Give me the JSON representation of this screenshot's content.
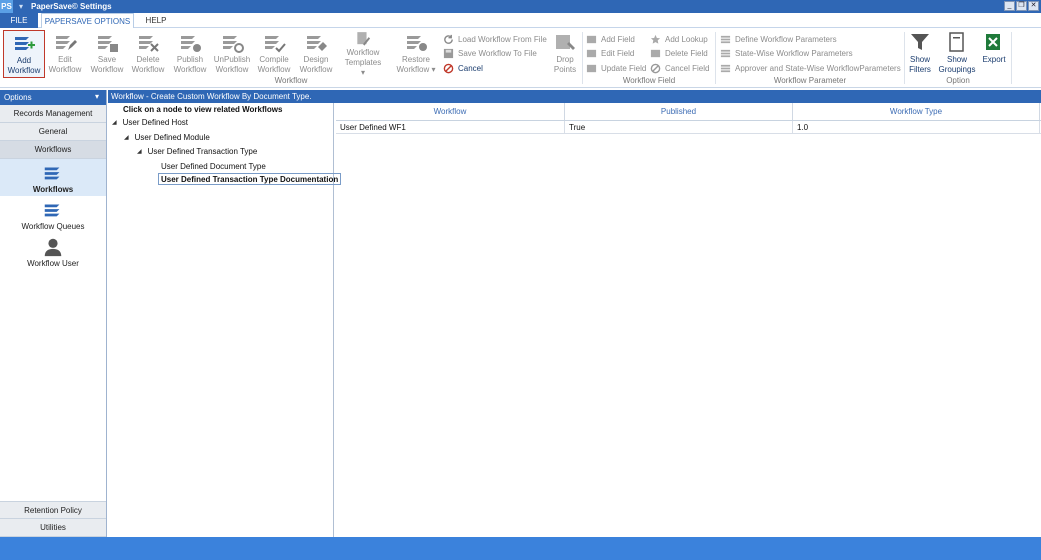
{
  "window": {
    "app_icon": "PS",
    "title": "PaperSave© Settings",
    "controls": [
      "_",
      "❐",
      "✕"
    ]
  },
  "menu": {
    "file": "FILE",
    "papersave": "PAPERSAVE OPTIONS",
    "help": "HELP"
  },
  "ribbon": {
    "workflow_buttons": [
      {
        "line1": "Add",
        "line2": "Workflow",
        "icon": "add-workflow-icon"
      },
      {
        "line1": "Edit",
        "line2": "Workflow",
        "icon": "edit-workflow-icon"
      },
      {
        "line1": "Save",
        "line2": "Workflow",
        "icon": "save-workflow-icon"
      },
      {
        "line1": "Delete",
        "line2": "Workflow",
        "icon": "delete-workflow-icon"
      },
      {
        "line1": "Publish",
        "line2": "Workflow",
        "icon": "publish-workflow-icon"
      },
      {
        "line1": "UnPublish",
        "line2": "Workflow",
        "icon": "unpublish-workflow-icon"
      },
      {
        "line1": "Compile",
        "line2": "Workflow",
        "icon": "compile-workflow-icon"
      },
      {
        "line1": "Design",
        "line2": "Workflow",
        "icon": "design-workflow-icon"
      },
      {
        "line1": "Workflow",
        "line2": "Templates ▾",
        "icon": "workflow-templates-icon"
      },
      {
        "line1": "Restore",
        "line2": "Workflow ▾",
        "icon": "restore-workflow-icon"
      }
    ],
    "file_actions": [
      "Load Workflow From File",
      "Save Workflow To File",
      "Cancel"
    ],
    "drop_points": {
      "line1": "Drop",
      "line2": "Points"
    },
    "workflow_group_label": "Workflow",
    "field_actions_left": [
      "Add Field",
      "Edit Field",
      "Update Field"
    ],
    "field_actions_right": [
      "Add Lookup",
      "Delete Field",
      "Cancel Field"
    ],
    "field_group_label": "Workflow Field",
    "parameter_actions": [
      "Define Workflow Parameters",
      "State-Wise Workflow Parameters",
      "Approver and State-Wise WorkflowParameters"
    ],
    "parameter_group_label": "Workflow Parameter",
    "option_buttons": [
      {
        "line1": "Show",
        "line2": "Filters"
      },
      {
        "line1": "Show",
        "line2": "Groupings"
      }
    ],
    "export": "Export",
    "option_group_label": "Option"
  },
  "left_panel": {
    "header": "Options",
    "pin": "📌",
    "top_buttons": [
      "Records Management",
      "General",
      "Workflows"
    ],
    "items": [
      "Workflows",
      "Workflow Queues",
      "Workflow User"
    ],
    "bottom_buttons": [
      "Retention Policy",
      "Utilities"
    ]
  },
  "content": {
    "header": "Workflow - Create Custom Workflow By Document Type.",
    "tree_hint": "Click on a node to view related Workflows",
    "tree": [
      "User Defined Host",
      "User Defined Module",
      "User Defined Transaction Type",
      "User Defined Document Type",
      "User Defined Transaction Type Documentation"
    ],
    "grid": {
      "columns": [
        "Workflow",
        "Published",
        "Workflow Type"
      ],
      "rows": [
        [
          "User Defined WF1",
          "True",
          "1.0"
        ]
      ]
    }
  },
  "colors": {
    "accent": "#2f67b5",
    "statusbar": "#3b82dc",
    "active_border": "#c0392b"
  }
}
